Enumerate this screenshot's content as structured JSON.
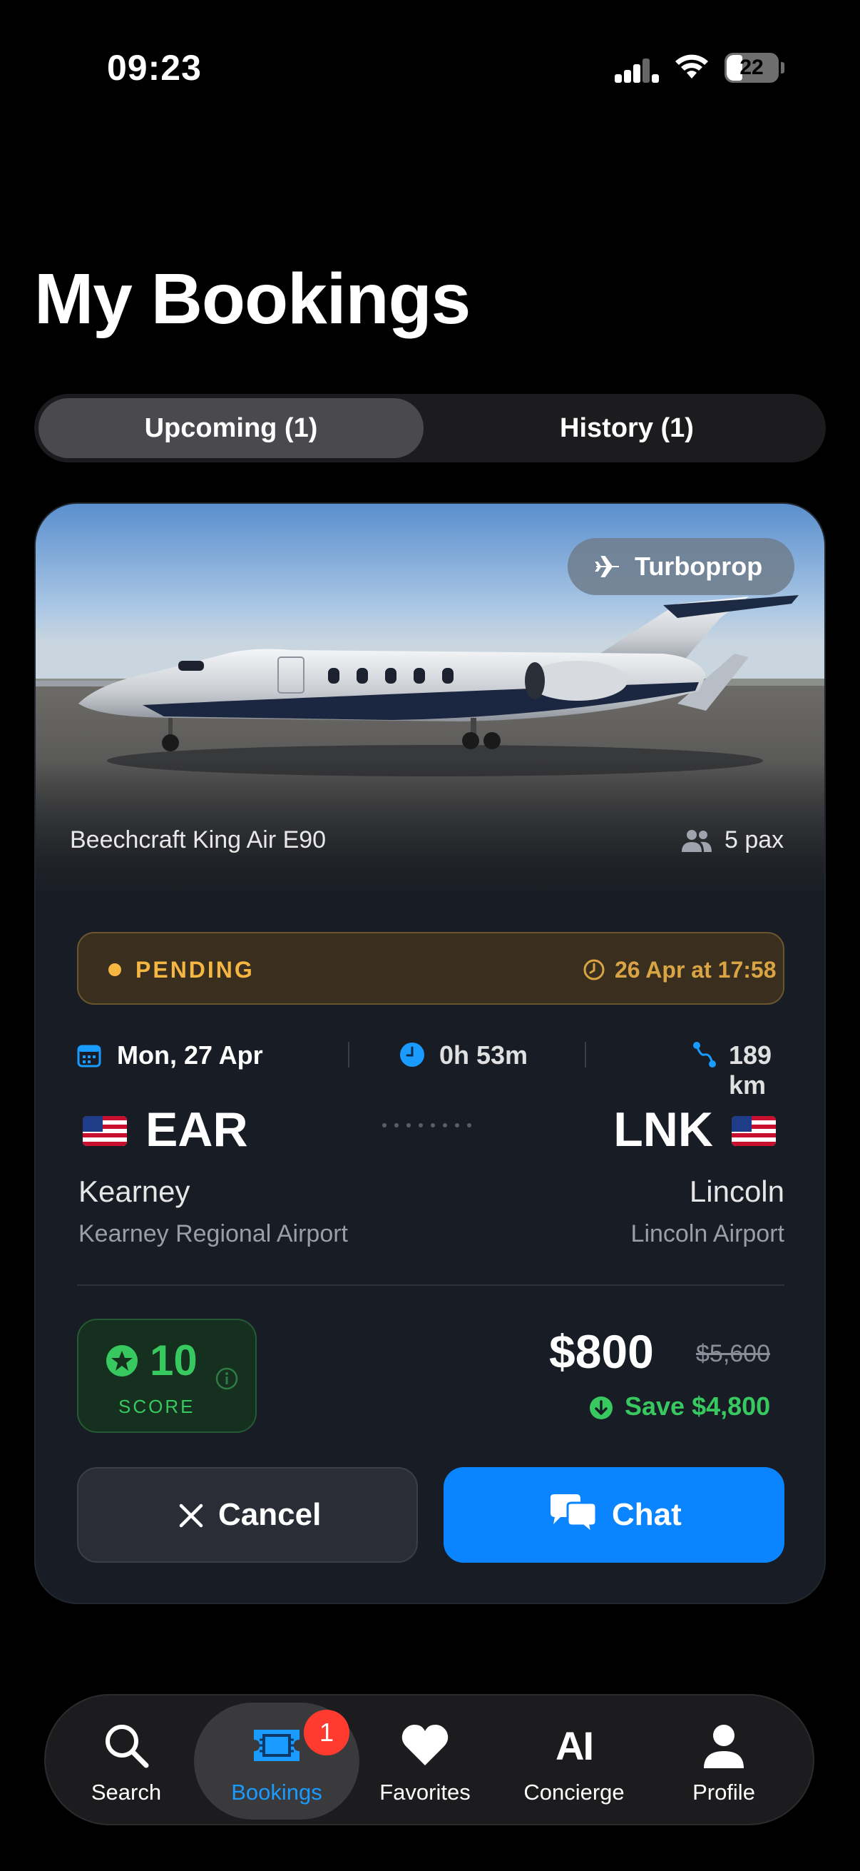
{
  "status_bar": {
    "time": "09:23",
    "battery": "22"
  },
  "page": {
    "title": "My Bookings"
  },
  "segments": [
    {
      "label": "Upcoming (1)",
      "active": true
    },
    {
      "label": "History (1)",
      "active": false
    }
  ],
  "booking": {
    "aircraft_type": "Turboprop",
    "aircraft_name": "Beechcraft King Air E90",
    "pax": "5 pax",
    "status": "PENDING",
    "status_time": "26 Apr at 17:58",
    "date": "Mon, 27 Apr",
    "duration": "0h 53m",
    "distance": "189 km",
    "from": {
      "code": "EAR",
      "city": "Kearney",
      "airport": "Kearney Regional Airport",
      "flag": "us-flag"
    },
    "to": {
      "code": "LNK",
      "city": "Lincoln",
      "airport": "Lincoln Airport",
      "flag": "us-flag"
    },
    "score": {
      "value": "10",
      "label": "SCORE"
    },
    "price": "$800",
    "original_price": "$5,600",
    "savings": "Save $4,800",
    "actions": {
      "cancel_label": "Cancel",
      "chat_label": "Chat"
    }
  },
  "tabbar": {
    "items": [
      {
        "label": "Search",
        "icon": "search-icon"
      },
      {
        "label": "Bookings",
        "icon": "ticket-icon",
        "active": true,
        "badge": "1"
      },
      {
        "label": "Favorites",
        "icon": "heart-icon"
      },
      {
        "label": "Concierge",
        "icon": "ai-icon",
        "icon_text": "AI"
      },
      {
        "label": "Profile",
        "icon": "person-icon"
      }
    ]
  },
  "colors": {
    "accent_blue": "#0a84ff",
    "pending_amber": "#f5b742",
    "success_green": "#37c960",
    "badge_red": "#ff3b30",
    "card_bg": "#181c25"
  }
}
